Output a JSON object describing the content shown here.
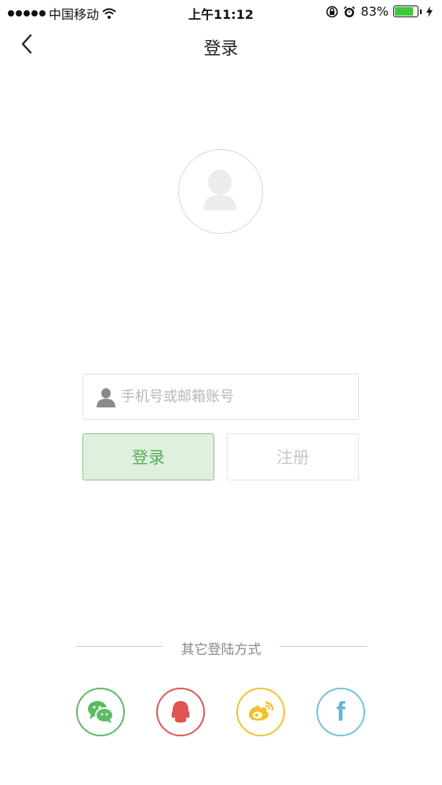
{
  "status_bar": {
    "carrier": "中国移动",
    "time": "上午11:12",
    "battery_text": "83%",
    "battery_level": 0.83
  },
  "nav": {
    "title": "登录"
  },
  "account_field": {
    "placeholder": "手机号或邮箱账号",
    "value": ""
  },
  "buttons": {
    "login": "登录",
    "register": "注册"
  },
  "other_login": {
    "label": "其它登陆方式",
    "providers": [
      "wechat-icon",
      "qq-icon",
      "weibo-icon",
      "facebook-icon"
    ]
  },
  "colors": {
    "wechat": "#5bbb62",
    "qq": "#e05454",
    "weibo": "#f3c12b",
    "facebook": "#6ec4d8",
    "login_fill": "#dff0df",
    "battery": "#3cc93c"
  }
}
